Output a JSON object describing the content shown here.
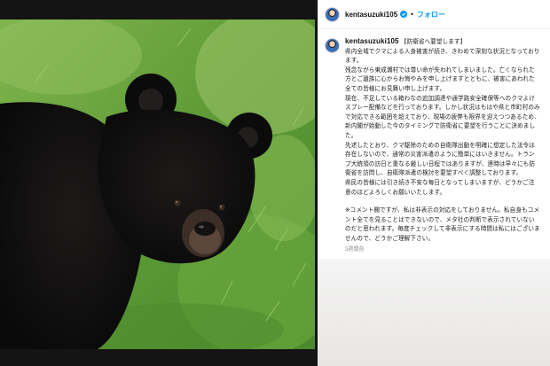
{
  "post": {
    "username": "kentasuzuki105",
    "follow_label": "フォロー",
    "separator": "•",
    "caption_lines": [
      "【防衛省へ要望します】",
      "県内全域でクマによる人身被害が続き、きわめて深刻な状況となっております。",
      "残念ながら東成瀬村では尊い命が失われてしまいました。亡くなられた方とご遺族に心からお悔やみを申し上げますとともに、被害にあわれた全ての皆様にお見舞い申し上げます。",
      "現在、不足している箱わなの追加調達や通学路安全確保等へのクマよけスプレー配備などを行っております。しかし状況はもはや県と市町村のみで対応できる範囲を超えており、現場の疲弊も限界を迎えつつあるため、新内閣が始動した今のタイミングで防衛省に要望を行うことに決めました。",
      "先述したとおり、クマ駆除のための自衛隊出動を明確に想定した法令は存在しないので、通常の災害派遣のように簡単にはいきません。トランプ大統領の訪日と重なる厳しい日程ではありますが、連時は早々にも防衛省を訪問し、自衛隊派遣の検討を要望すべく調整しております。",
      "県民の皆様には引き続き不安な毎日となってしまいますが、どうかご注意のほどよろしくお願いいたします。"
    ],
    "comment_note": "※コメント欄ですが、私は非表示の対応をしておりません。私自身もコメント全てを見ることはできないので、メタ社の判断で表示されていないのだと思われます。毎度チェックして非表示にする時間は私にはございませんので、どうかご理解下さい。",
    "timestamp": "3週間前"
  },
  "icons": {
    "verified": "verified-badge-icon",
    "avatar": "profile-avatar",
    "photo": "black-bear-photo"
  },
  "colors": {
    "accent": "#0095f6",
    "background": "#141414",
    "panel": "#ffffff"
  }
}
